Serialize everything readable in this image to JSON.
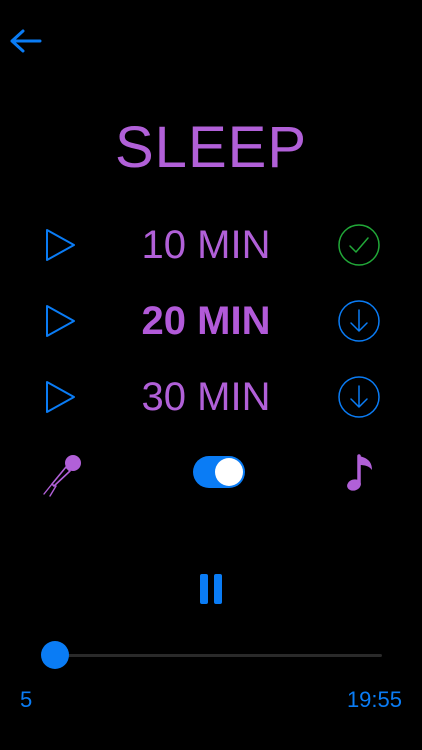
{
  "colors": {
    "accent_blue": "#0a7cf5",
    "purple": "#b160d8",
    "purple_bold": "#b25ad9",
    "success_green": "#21a838",
    "track": "#2a2a2a"
  },
  "header": {
    "back_icon": "arrow-left-icon"
  },
  "title": "SLEEP",
  "durations": [
    {
      "label": "10 MIN",
      "status": "downloaded",
      "status_icon": "check-circle-icon",
      "active": false
    },
    {
      "label": "20 MIN",
      "status": "not-downloaded",
      "status_icon": "download-circle-icon",
      "active": true
    },
    {
      "label": "30 MIN",
      "status": "not-downloaded",
      "status_icon": "download-circle-icon",
      "active": false
    }
  ],
  "controls": {
    "voice_icon": "microphone-icon",
    "toggle_on": true,
    "music_icon": "music-note-icon",
    "pause_icon": "pause-icon"
  },
  "progress": {
    "fraction": 0.0,
    "elapsed": "5",
    "remaining": "19:55"
  }
}
